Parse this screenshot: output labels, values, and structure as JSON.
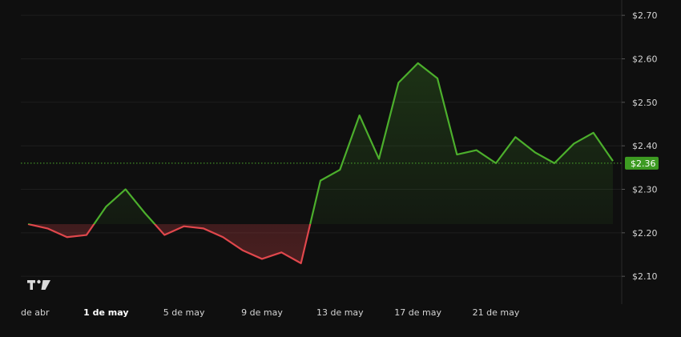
{
  "chart_data": {
    "type": "area",
    "baseline": 2.22,
    "current_price": 2.36,
    "current_price_label": "$2.36",
    "ylim": [
      2.07,
      2.72
    ],
    "y_ticks": [
      {
        "value": 2.1,
        "label": "$2.10"
      },
      {
        "value": 2.2,
        "label": "$2.20"
      },
      {
        "value": 2.3,
        "label": "$2.30"
      },
      {
        "value": 2.4,
        "label": "$2.40"
      },
      {
        "value": 2.5,
        "label": "$2.50"
      },
      {
        "value": 2.6,
        "label": "$2.60"
      },
      {
        "value": 2.7,
        "label": "$2.70"
      }
    ],
    "x_ticks": [
      {
        "date": "2024-04-27",
        "label": "de abr",
        "bold": false
      },
      {
        "date": "2024-05-01",
        "label": "1 de may",
        "bold": true
      },
      {
        "date": "2024-05-05",
        "label": "5 de may",
        "bold": false
      },
      {
        "date": "2024-05-09",
        "label": "9 de may",
        "bold": false
      },
      {
        "date": "2024-05-13",
        "label": "13 de may",
        "bold": false
      },
      {
        "date": "2024-05-17",
        "label": "17 de may",
        "bold": false
      },
      {
        "date": "2024-05-21",
        "label": "21 de may",
        "bold": false
      }
    ],
    "x_range": [
      "2024-04-26",
      "2024-05-26"
    ],
    "series": [
      {
        "points": [
          {
            "x": "2024-04-27",
            "y": 2.22
          },
          {
            "x": "2024-04-28",
            "y": 2.21
          },
          {
            "x": "2024-04-29",
            "y": 2.19
          },
          {
            "x": "2024-04-30",
            "y": 2.195
          },
          {
            "x": "2024-05-01",
            "y": 2.26
          },
          {
            "x": "2024-05-02",
            "y": 2.3
          },
          {
            "x": "2024-05-03",
            "y": 2.245
          },
          {
            "x": "2024-05-04",
            "y": 2.195
          },
          {
            "x": "2024-05-05",
            "y": 2.215
          },
          {
            "x": "2024-05-06",
            "y": 2.21
          },
          {
            "x": "2024-05-07",
            "y": 2.19
          },
          {
            "x": "2024-05-08",
            "y": 2.16
          },
          {
            "x": "2024-05-09",
            "y": 2.14
          },
          {
            "x": "2024-05-10",
            "y": 2.155
          },
          {
            "x": "2024-05-11",
            "y": 2.13
          },
          {
            "x": "2024-05-12",
            "y": 2.32
          },
          {
            "x": "2024-05-13",
            "y": 2.345
          },
          {
            "x": "2024-05-14",
            "y": 2.47
          },
          {
            "x": "2024-05-15",
            "y": 2.37
          },
          {
            "x": "2024-05-16",
            "y": 2.545
          },
          {
            "x": "2024-05-17",
            "y": 2.59
          },
          {
            "x": "2024-05-18",
            "y": 2.555
          },
          {
            "x": "2024-05-19",
            "y": 2.38
          },
          {
            "x": "2024-05-20",
            "y": 2.39
          },
          {
            "x": "2024-05-21",
            "y": 2.36
          },
          {
            "x": "2024-05-22",
            "y": 2.42
          },
          {
            "x": "2024-05-23",
            "y": 2.385
          },
          {
            "x": "2024-05-24",
            "y": 2.36
          },
          {
            "x": "2024-05-25",
            "y": 2.405
          },
          {
            "x": "2024-05-26",
            "y": 2.43
          },
          {
            "x": "2024-05-27",
            "y": 2.365
          }
        ]
      }
    ],
    "colors": {
      "up": "#4caf2c",
      "down": "#e0474c",
      "background": "#0f0f0f",
      "grid": "#1e1e1e",
      "price_tag": "#3d9b22"
    },
    "grid": true,
    "logo_icon": "tradingview-logo-icon"
  }
}
